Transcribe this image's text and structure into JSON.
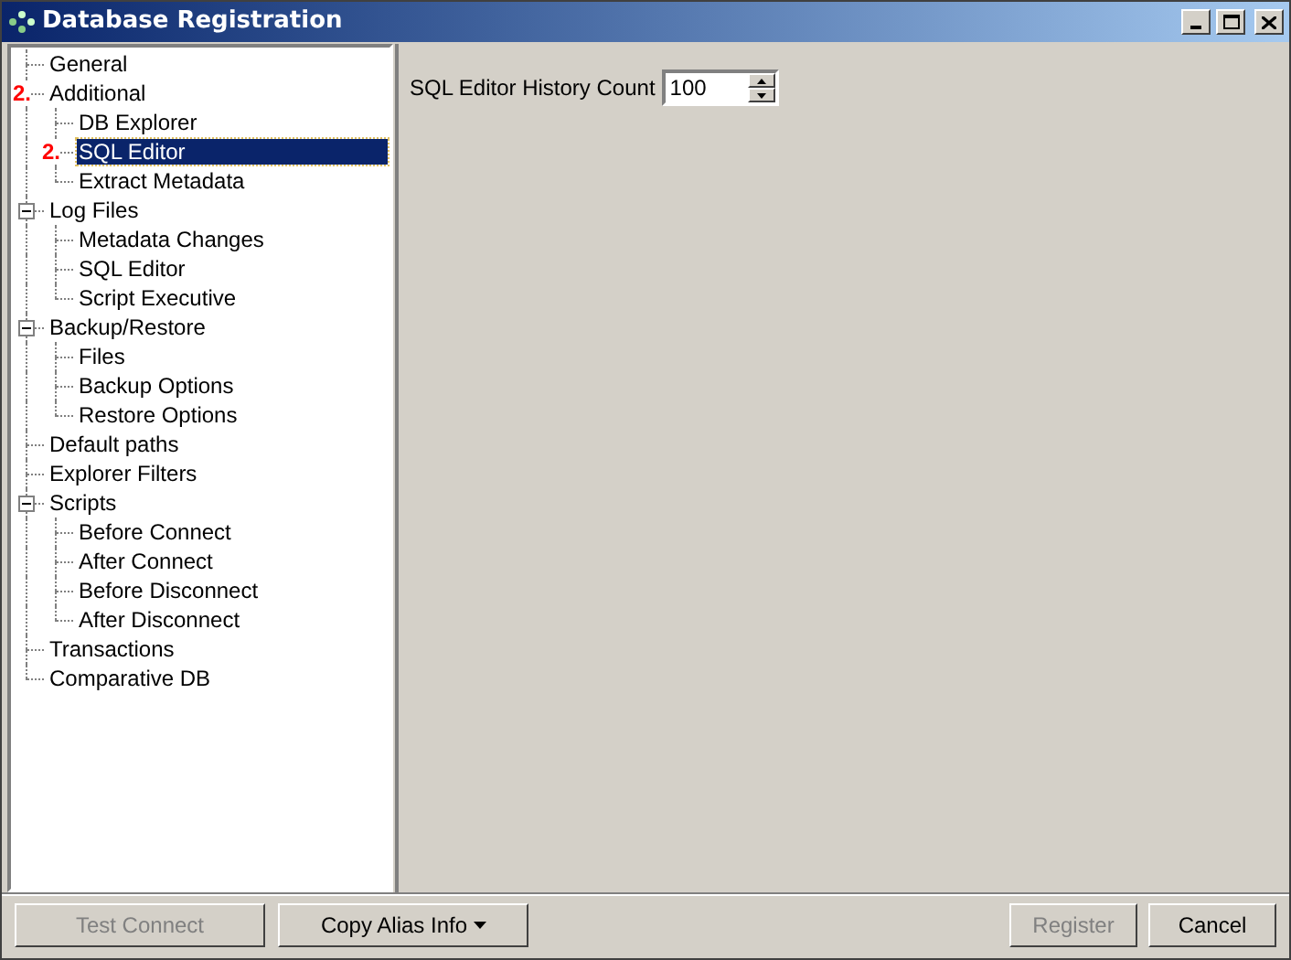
{
  "window": {
    "title": "Database Registration"
  },
  "tree": [
    {
      "label": "General",
      "selected": false
    },
    {
      "label": "Additional",
      "selected": false,
      "marker": "2.",
      "children": [
        {
          "label": "DB Explorer",
          "selected": false
        },
        {
          "label": "SQL Editor",
          "selected": true,
          "marker": "2."
        },
        {
          "label": "Extract Metadata",
          "selected": false
        }
      ]
    },
    {
      "label": "Log Files",
      "selected": false,
      "expanded": true,
      "children": [
        {
          "label": "Metadata Changes",
          "selected": false
        },
        {
          "label": "SQL Editor",
          "selected": false
        },
        {
          "label": "Script Executive",
          "selected": false
        }
      ]
    },
    {
      "label": "Backup/Restore",
      "selected": false,
      "expanded": true,
      "children": [
        {
          "label": "Files",
          "selected": false
        },
        {
          "label": "Backup Options",
          "selected": false
        },
        {
          "label": "Restore Options",
          "selected": false
        }
      ]
    },
    {
      "label": "Default paths",
      "selected": false
    },
    {
      "label": "Explorer Filters",
      "selected": false
    },
    {
      "label": "Scripts",
      "selected": false,
      "expanded": true,
      "children": [
        {
          "label": "Before Connect",
          "selected": false
        },
        {
          "label": "After Connect",
          "selected": false
        },
        {
          "label": "Before Disconnect",
          "selected": false
        },
        {
          "label": "After Disconnect",
          "selected": false
        }
      ]
    },
    {
      "label": "Transactions",
      "selected": false
    },
    {
      "label": "Comparative DB",
      "selected": false
    }
  ],
  "setting": {
    "label": "SQL Editor History Count",
    "value": "100"
  },
  "buttons": [
    {
      "label": "Test Connect",
      "disabled": true,
      "kind": "plain"
    },
    {
      "label": "Copy Alias Info",
      "disabled": false,
      "kind": "dropdown"
    },
    {
      "label": "Register",
      "disabled": true,
      "kind": "plain"
    },
    {
      "label": "Cancel",
      "disabled": false,
      "kind": "plain"
    }
  ]
}
